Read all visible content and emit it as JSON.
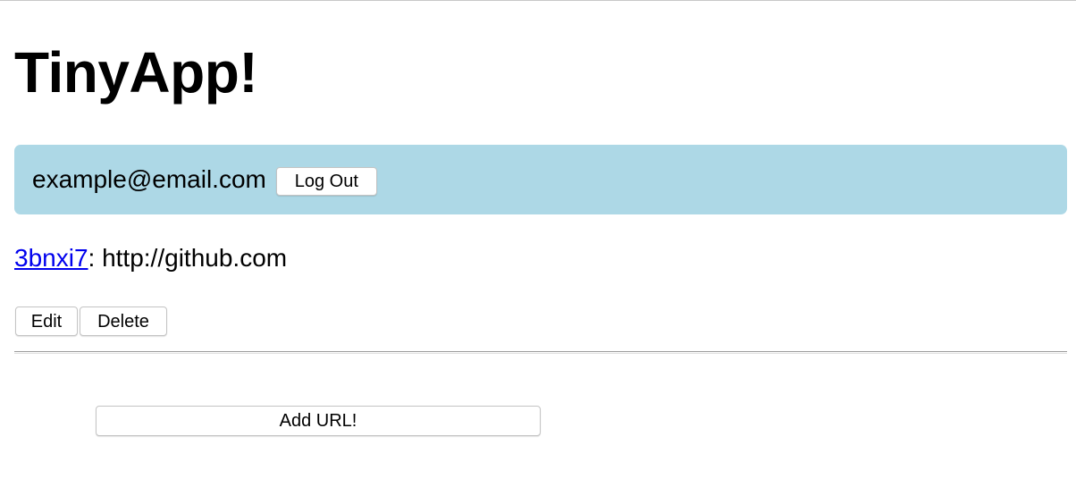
{
  "app": {
    "title": "TinyApp!"
  },
  "user_bar": {
    "email": "example@email.com",
    "logout_label": "Log Out",
    "background_color": "#add8e6"
  },
  "urls": [
    {
      "short_id": "3bnxi7",
      "separator": ":",
      "long_url": "http://github.com",
      "edit_label": "Edit",
      "delete_label": "Delete"
    }
  ],
  "add_url": {
    "label": "Add URL!"
  }
}
